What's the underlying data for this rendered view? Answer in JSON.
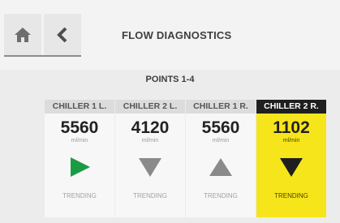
{
  "header": {
    "title": "FLOW DIAGNOSTICS"
  },
  "section": {
    "title": "POINTS 1-4"
  },
  "colors": {
    "active_bg": "#f6e51b",
    "arrow_up_green": "#1a9c45",
    "arrow_gray": "#8a8a8a"
  },
  "cards": [
    {
      "name": "CHILLER 1 L.",
      "value": "5560",
      "unit": "ml/min",
      "trend": "TRENDING",
      "arrow_icon": "play-right-icon"
    },
    {
      "name": "CHILLER 2 L.",
      "value": "4120",
      "unit": "ml/min",
      "trend": "TRENDING",
      "arrow_icon": "triangle-down-icon"
    },
    {
      "name": "CHILLER 1 R.",
      "value": "5560",
      "unit": "ml/min",
      "trend": "TRENDING",
      "arrow_icon": "triangle-up-icon"
    },
    {
      "name": "CHILLER 2 R.",
      "value": "1102",
      "unit": "ml/min",
      "trend": "TRENDING",
      "arrow_icon": "triangle-down-icon"
    }
  ]
}
